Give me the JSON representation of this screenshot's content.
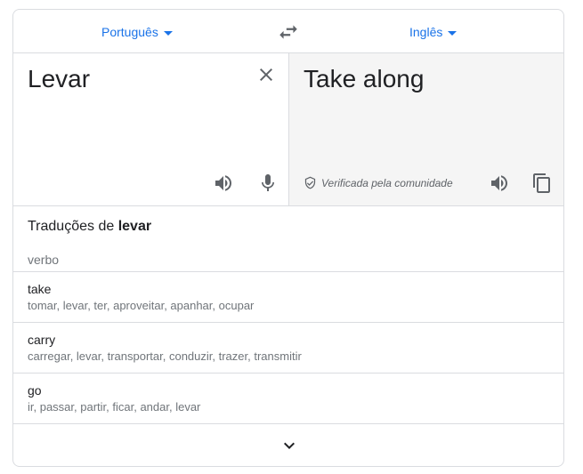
{
  "languages": {
    "source": "Português",
    "target": "Inglês"
  },
  "source_pane": {
    "text": "Levar"
  },
  "target_pane": {
    "text": "Take along",
    "verified_label": "Verificada pela comunidade"
  },
  "translations": {
    "title_prefix": "Traduções de",
    "title_word": "levar",
    "part_of_speech": "verbo",
    "entries": [
      {
        "word": "take",
        "synonyms": "tomar, levar, ter, aproveitar, apanhar, ocupar"
      },
      {
        "word": "carry",
        "synonyms": "carregar, levar, transportar, conduzir, trazer, transmitir"
      },
      {
        "word": "go",
        "synonyms": "ir, passar, partir, ficar, andar, levar"
      }
    ]
  },
  "icons": {
    "swap": "swap-languages-icon",
    "close": "close-icon",
    "speaker": "speaker-icon",
    "mic": "microphone-icon",
    "verified": "shield-check-icon",
    "copy": "copy-icon",
    "expand": "chevron-down-icon"
  },
  "colors": {
    "accent": "#1a73e8",
    "icon": "#5f6368",
    "muted_text": "#70757a",
    "target_bg": "#f5f5f5",
    "border": "#dadce0"
  }
}
